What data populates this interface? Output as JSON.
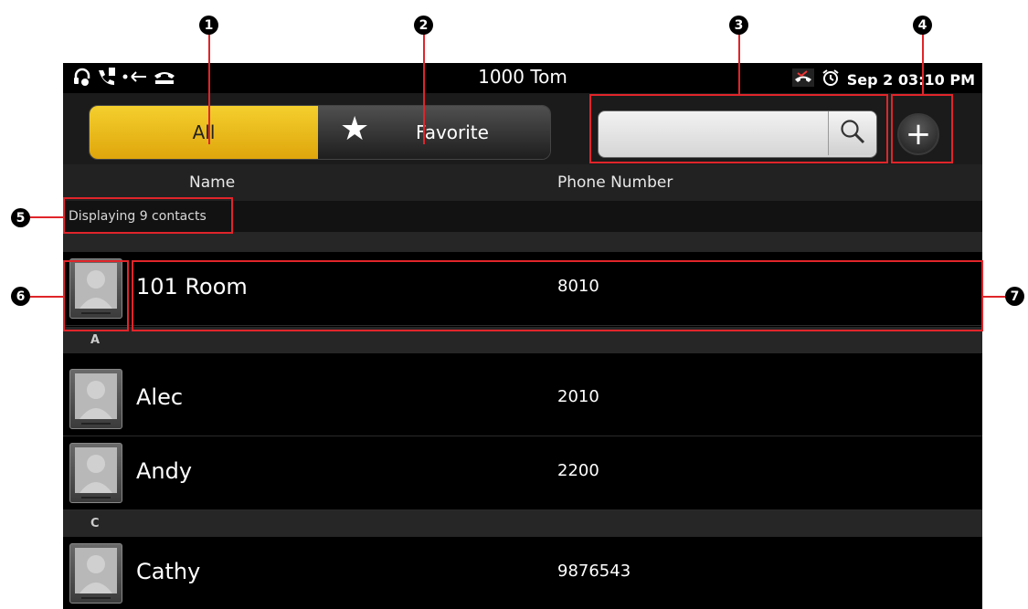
{
  "status_bar": {
    "title": "1000  Tom",
    "datetime": "Sep 2 03:10 PM",
    "icons": [
      "headset-icon",
      "call-forward-icon",
      "call-back-icon",
      "phone-handset-icon",
      "missed-call-icon",
      "alarm-icon"
    ]
  },
  "tabs": {
    "all_label": "All",
    "favorite_label": "Favorite",
    "active": "All",
    "accent_color": "#f1c21b"
  },
  "search": {
    "placeholder": "",
    "value": ""
  },
  "add_button": {
    "label": "+"
  },
  "columns": {
    "name": "Name",
    "phone": "Phone Number"
  },
  "contact_count_text": "Displaying 9 contacts",
  "contacts": [
    {
      "name": "101 Room",
      "phone": "8010"
    },
    {
      "section": "A"
    },
    {
      "name": "Alec",
      "phone": "2010"
    },
    {
      "name": "Andy",
      "phone": "2200"
    },
    {
      "section": "C"
    },
    {
      "name": "Cathy",
      "phone": "9876543"
    }
  ],
  "callouts": [
    "1",
    "2",
    "3",
    "4",
    "5",
    "6",
    "7"
  ],
  "annotation_color": "#e0252a"
}
